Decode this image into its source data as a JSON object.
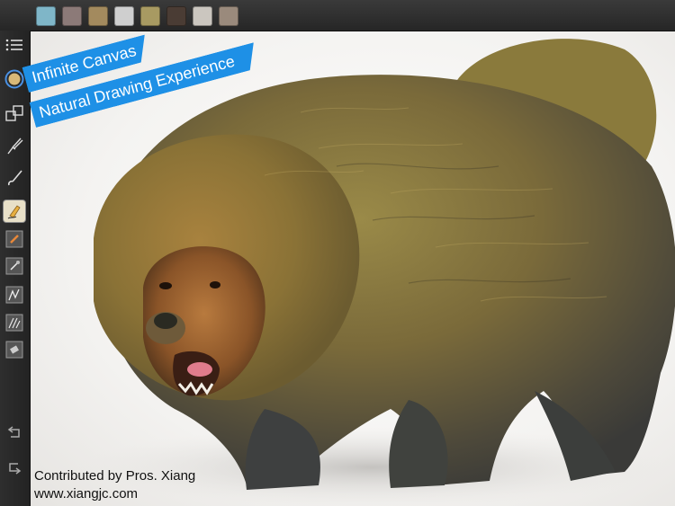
{
  "palette": {
    "swatches": [
      "#7fb6c8",
      "#8c7a78",
      "#a38a5e",
      "#cfcfcf",
      "#a89a62",
      "#4a3c34",
      "#cbc6bf",
      "#9a8a7c"
    ]
  },
  "toolbar": {
    "tools": [
      "menu-icon",
      "color-circle-icon",
      "layers-icon",
      "smudge-brush-icon",
      "brush-icon",
      "marker-icon",
      "pencil-icon",
      "airbrush-icon",
      "ink-pen-icon",
      "fine-pen-icon",
      "eraser-icon",
      "undo-icon",
      "redo-icon"
    ]
  },
  "banners": {
    "line1": "Infinite Canvas",
    "line2": "Natural Drawing Experience"
  },
  "credits": {
    "contributor": "Contributed by Pros. Xiang",
    "website": "www.xiangjc.com"
  },
  "colors": {
    "banner": "#1e90e6",
    "color_picker": "#d8b878"
  }
}
